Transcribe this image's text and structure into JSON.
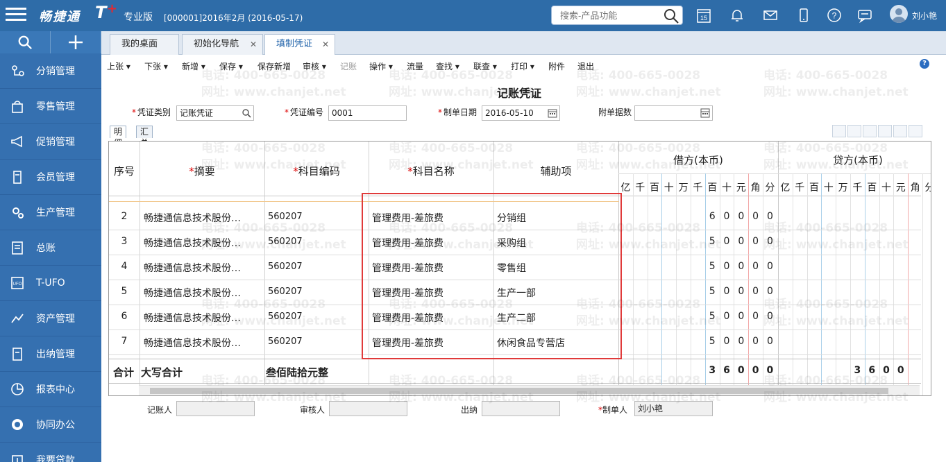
{
  "app": {
    "brand": "畅捷通",
    "brand_t": "T",
    "brand_plus": "+",
    "edition": "专业版",
    "account": "[000001]2016年2月   (2016-05-17)",
    "search_placeholder": "搜索-产品功能",
    "calendar_day": "15",
    "user": "刘小艳"
  },
  "sidebar": {
    "items": [
      {
        "label": "分销管理",
        "icon": "distribution-icon"
      },
      {
        "label": "零售管理",
        "icon": "retail-icon"
      },
      {
        "label": "促销管理",
        "icon": "megaphone-icon"
      },
      {
        "label": "会员管理",
        "icon": "member-icon"
      },
      {
        "label": "生产管理",
        "icon": "gears-icon"
      },
      {
        "label": "总账",
        "icon": "ledger-icon"
      },
      {
        "label": "T-UFO",
        "icon": "ufo-icon"
      },
      {
        "label": "资产管理",
        "icon": "asset-icon"
      },
      {
        "label": "出纳管理",
        "icon": "cashier-icon"
      },
      {
        "label": "报表中心",
        "icon": "pie-chart-icon"
      },
      {
        "label": "协同办公",
        "icon": "collab-icon"
      },
      {
        "label": "我要贷款",
        "icon": "loan-icon"
      }
    ]
  },
  "tabs": [
    {
      "label": "我的桌面",
      "closable": false,
      "active": false
    },
    {
      "label": "初始化导航",
      "closable": true,
      "active": false
    },
    {
      "label": "填制凭证",
      "closable": true,
      "active": true
    }
  ],
  "toolbar": {
    "items": [
      "上张 ▾",
      "下张 ▾",
      "新增 ▾",
      "保存 ▾",
      "保存新增",
      "审核 ▾",
      "记账",
      "操作 ▾",
      "流量",
      "查找 ▾",
      "联查 ▾",
      "打印 ▾",
      "附件",
      "退出"
    ],
    "disabled": "记账",
    "help": "?"
  },
  "voucher": {
    "title": "记账凭证",
    "type_label": "凭证类别",
    "type_value": "记账凭证",
    "number_label": "凭证编号",
    "number_value": "0001",
    "date_label": "制单日期",
    "date_value": "2016-05-10",
    "attach_label": "附单据数",
    "attach_value": "",
    "subtab_detail": "明细",
    "subtab_summary": "汇总"
  },
  "grid": {
    "headers": {
      "seq": "序号",
      "summary": "摘要",
      "code": "科目编码",
      "name": "科目名称",
      "aux": "辅助项",
      "debit": "借方(本币)",
      "credit": "贷方(本币)"
    },
    "required_mark": "*",
    "digit_units": [
      "亿",
      "千",
      "百",
      "十",
      "万",
      "千",
      "百",
      "十",
      "元",
      "角",
      "分"
    ],
    "credit_units_visible": [
      "亿",
      "千",
      "百",
      "十",
      "万",
      "千",
      "百",
      "十",
      "元",
      "角",
      "分"
    ],
    "rows": [
      {
        "seq": "2",
        "summary": "畅捷通信息技术股份…",
        "code": "560207",
        "name": "管理费用-差旅费",
        "aux": "分销组",
        "debit": "60000"
      },
      {
        "seq": "3",
        "summary": "畅捷通信息技术股份…",
        "code": "560207",
        "name": "管理费用-差旅费",
        "aux": "采购组",
        "debit": "50000"
      },
      {
        "seq": "4",
        "summary": "畅捷通信息技术股份…",
        "code": "560207",
        "name": "管理费用-差旅费",
        "aux": "零售组",
        "debit": "50000"
      },
      {
        "seq": "5",
        "summary": "畅捷通信息技术股份…",
        "code": "560207",
        "name": "管理费用-差旅费",
        "aux": "生产一部",
        "debit": "50000"
      },
      {
        "seq": "6",
        "summary": "畅捷通信息技术股份…",
        "code": "560207",
        "name": "管理费用-差旅费",
        "aux": "生产二部",
        "debit": "50000"
      },
      {
        "seq": "7",
        "summary": "畅捷通信息技术股份…",
        "code": "560207",
        "name": "管理费用-差旅费",
        "aux": "休闲食品专营店",
        "debit": "50000"
      }
    ],
    "total_label": "合计",
    "total_words_label": "大写合计",
    "total_words": "叁佰陆拾元整",
    "total_debit": "36000",
    "total_credit": "3600"
  },
  "footer": {
    "bookkeeper_label": "记账人",
    "bookkeeper": "",
    "auditor_label": "审核人",
    "auditor": "",
    "cashier_label": "出纳",
    "cashier": "",
    "maker_label": "制单人",
    "maker": "刘小艳"
  },
  "watermark": {
    "phone": "电话: 400-665-0028",
    "site": "网址: www.chanjet.net"
  },
  "colors": {
    "topbar": "#2e6ca8",
    "sidebar": "#3570b0",
    "highlight": "#e03a3a",
    "required": "#dd0000"
  }
}
